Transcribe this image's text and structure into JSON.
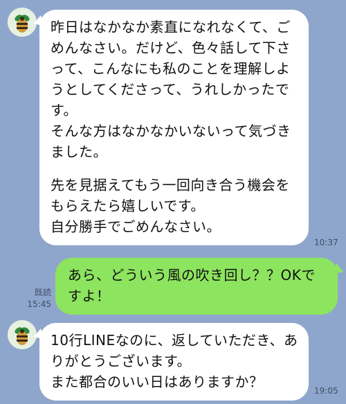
{
  "messages": [
    {
      "direction": "incoming",
      "lines": [
        "昨日はなかなか素直になれなくて、ご",
        "めんなさい。だけど、色々話して下さ",
        "って、こんなにも私のことを理解しよ",
        "うとしてくださって、うれしかったで",
        "す。",
        "そんな方はなかなかいないって気づき",
        "ました。",
        "",
        "先を見据えてもう一回向き合う機会を",
        "もらえたら嬉しいです。",
        "自分勝手でごめんなさい。"
      ],
      "time": "10:37"
    },
    {
      "direction": "outgoing",
      "lines": [
        "あら、どういう風の吹き回し？？OKで",
        "すよ！"
      ],
      "read_label": "既読",
      "time": "15:45"
    },
    {
      "direction": "incoming",
      "lines": [
        "10行LINEなのに、返していただき、あ",
        "りがとうございます。",
        "また都合のいい日はありますか？"
      ],
      "time": "19:05"
    }
  ],
  "contact": {
    "avatar_icon": "bee-icon"
  },
  "colors": {
    "background": "#8fa6cc",
    "incoming_bubble": "#ffffff",
    "outgoing_bubble": "#8de45f"
  }
}
